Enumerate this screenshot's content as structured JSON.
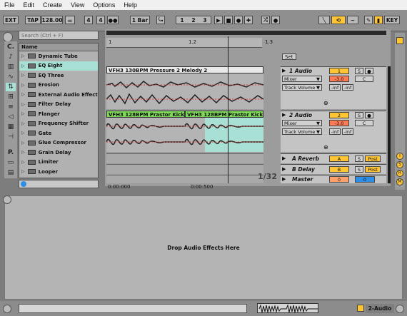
{
  "menu": [
    "File",
    "Edit",
    "Create",
    "View",
    "Options",
    "Help"
  ],
  "transport": {
    "ext": "EXT",
    "tap": "TAP",
    "tempo": "128.00",
    "sig_num": "4",
    "sig_den": "4",
    "quant": "1 Bar",
    "pos_bar": "1",
    "pos_beat": "2",
    "pos_sixteenth": "3",
    "key": "KEY"
  },
  "browser": {
    "search_placeholder": "Search (Ctrl + F)",
    "categories": [
      "C.",
      "P."
    ],
    "column_header": "Name",
    "items": [
      "Dynamic Tube",
      "EQ Eight",
      "EQ Three",
      "Erosion",
      "External Audio Effect",
      "Filter Delay",
      "Flanger",
      "Frequency Shifter",
      "Gate",
      "Glue Compressor",
      "Grain Delay",
      "Limiter",
      "Looper"
    ],
    "selected_index": 1
  },
  "ruler": {
    "marks": [
      "1",
      "1.2",
      "1.3"
    ]
  },
  "set_button": "Set",
  "clips": [
    {
      "name": "VFH3 130BPM Pressure 2 Melody 2",
      "color": "#e8e8e8"
    },
    {
      "name": "VFH3 128BPM Prastor Kick 1",
      "color": "#7ed957"
    },
    {
      "name": "VFH3 128BPM Prastor Kick 1",
      "color": "#7ed957"
    }
  ],
  "tracks": [
    {
      "name": "1 Audio",
      "num": "1",
      "routing": "Mixer",
      "chooser": "Track Volume",
      "vol": "-3.0",
      "pan": "C",
      "solo": "S",
      "sendA": "-inf",
      "sendB": "-inf"
    },
    {
      "name": "2 Audio",
      "num": "2",
      "routing": "Mixer",
      "chooser": "Track Volume",
      "vol": "-3.0",
      "pan": "C",
      "solo": "S",
      "sendA": "-inf",
      "sendB": "-inf"
    }
  ],
  "returns": [
    {
      "name": "A Reverb",
      "letter": "A",
      "solo": "S",
      "post": "Post"
    },
    {
      "name": "B Delay",
      "letter": "B",
      "solo": "S",
      "post": "Post"
    }
  ],
  "master": {
    "name": "Master",
    "num": "0",
    "solo": "0"
  },
  "time_labels": [
    "0:00:000",
    "0:00:500"
  ],
  "grid_label": "1/32",
  "drop_text": "Drop Audio Effects Here",
  "status_track": "2-Audio",
  "colors": {
    "accent": "#ffc534",
    "selection": "#a8e0d6",
    "clip_green": "#7ed957",
    "vol_red": "#ff7b55",
    "send_blue": "#2d8ee8"
  }
}
